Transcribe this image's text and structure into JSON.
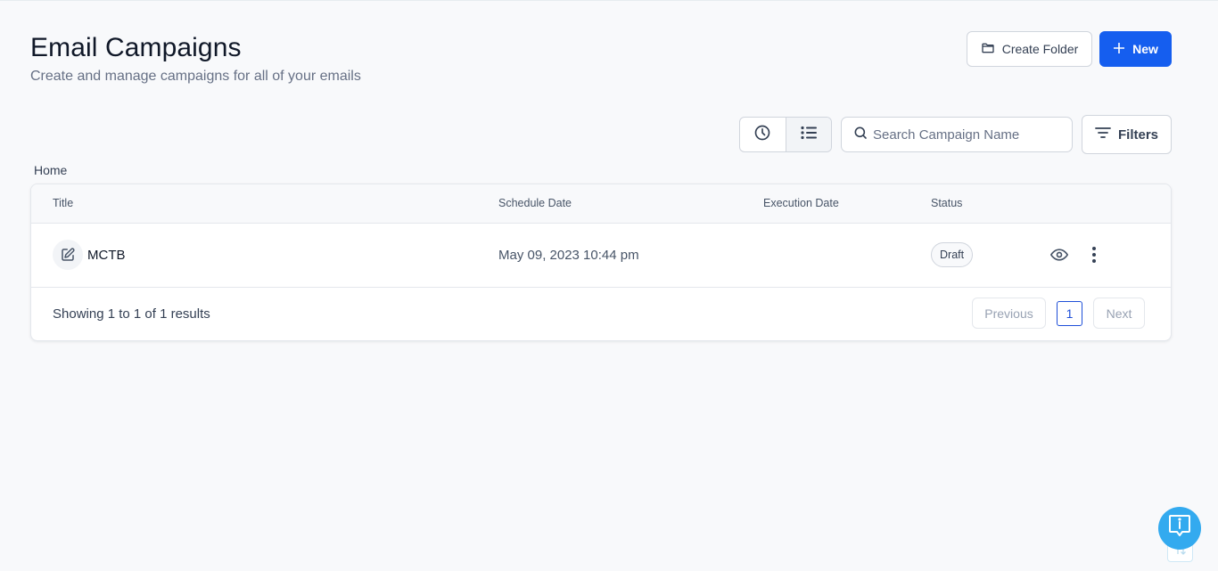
{
  "header": {
    "title": "Email Campaigns",
    "subtitle": "Create and manage campaigns for all of your emails"
  },
  "actions": {
    "create_folder_label": "Create Folder",
    "new_label": "New"
  },
  "toolbar": {
    "view_modes": [
      {
        "name": "schedule-view",
        "icon": "clock-icon",
        "active": false
      },
      {
        "name": "list-view",
        "icon": "list-icon",
        "active": true
      }
    ],
    "search_placeholder": "Search Campaign Name",
    "search_value": "",
    "filters_label": "Filters"
  },
  "breadcrumb": "Home",
  "table": {
    "columns": [
      "Title",
      "Schedule Date",
      "Execution Date",
      "Status"
    ],
    "rows": [
      {
        "title": "MCTB",
        "icon": "edit-icon",
        "schedule_date": "May 09, 2023 10:44 pm",
        "execution_date": "",
        "status": "Draft",
        "actions": [
          "eye-icon",
          "more-vertical-icon"
        ]
      }
    ]
  },
  "pagination": {
    "summary": "Showing 1 to 1 of 1 results",
    "previous_label": "Previous",
    "current_page": "1",
    "next_label": "Next"
  },
  "colors": {
    "primary": "#155eef",
    "help_fab": "#33aaef",
    "background": "#f8f9fb"
  }
}
